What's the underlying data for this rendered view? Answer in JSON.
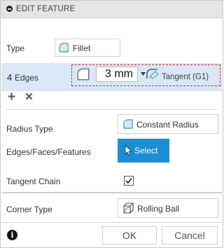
{
  "header": {
    "title": "EDIT FEATURE"
  },
  "type_row": {
    "label": "Type",
    "value": "Fillet"
  },
  "edges_row": {
    "count": "4",
    "label": "Edges",
    "radius": "3 mm",
    "continuity": "Tangent (G1)",
    "add_symbol": "+",
    "remove_symbol": "×"
  },
  "radius_type": {
    "label": "Radius Type",
    "value": "Constant Radius"
  },
  "edges_faces": {
    "label": "Edges/Faces/Features",
    "button": "Select"
  },
  "tangent_chain": {
    "label": "Tangent Chain",
    "checked": true
  },
  "corner_type": {
    "label": "Corner Type",
    "value": "Rolling Ball"
  },
  "footer": {
    "info": "i",
    "ok": "OK",
    "cancel": "Cancel"
  },
  "colors": {
    "accent": "#1a8fd6",
    "selection": "#d9e7f7",
    "dashed": "#d9302c"
  }
}
